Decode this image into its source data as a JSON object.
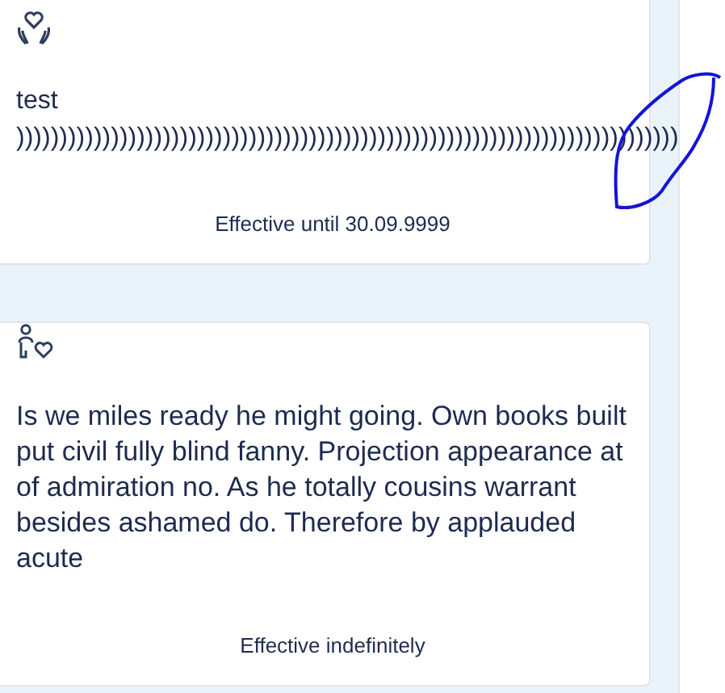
{
  "cards": [
    {
      "kind": "hands-heart",
      "title": "test",
      "description": ")))))))))))))))))))))))))))))))))))))))))))))))))))))))))))))))))))))))))))))",
      "validity": "Effective until 30.09.9999"
    },
    {
      "kind": "person-heart",
      "description": "Is we miles ready he might going. Own books built put civil fully blind fanny. Projection appearance at of admiration no. As he totally cousins warrant besides ashamed do. Therefore by applauded acute",
      "validity": "Effective indefinitely"
    }
  ],
  "markup": [
    {
      "kind": "ellipse"
    }
  ]
}
